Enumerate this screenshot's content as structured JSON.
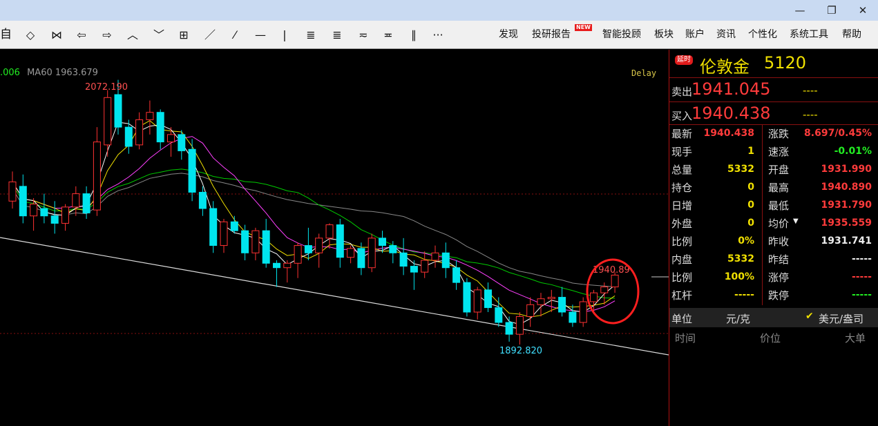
{
  "window": {
    "minimize": "—",
    "restore": "❐",
    "close": "✕"
  },
  "toolbar": {
    "first_char": "自",
    "icons": [
      "prev-icon",
      "next-icon",
      "left-arrow-icon",
      "right-arrow-icon",
      "zoom-in-icon",
      "zoom-out-icon",
      "layout-icon",
      "trend-line-icon",
      "dash-line-icon",
      "h-line-icon",
      "v-line-icon",
      "chan-icon",
      "fib-icon",
      "gann-icon",
      "cross-icon",
      "parallel-icon",
      "more-icon"
    ],
    "icon_glyphs": [
      "◇",
      "⋈",
      "⇦",
      "⇨",
      "︿",
      "﹀",
      "⊞",
      "／",
      "⁄",
      "—",
      "|",
      "≣",
      "≣",
      "≂",
      "≖",
      "∥",
      "···"
    ],
    "menu": [
      "发现",
      "投研报告",
      "智能投顾",
      "板块",
      "账户",
      "资讯",
      "个性化",
      "系统工具",
      "帮助"
    ],
    "new_badge": "NEW"
  },
  "chart": {
    "ma_label_1": ".006",
    "ma_label_2": "MA60 1963.679",
    "delay_label": "Delay",
    "high_label": "2072.190",
    "low_label": "1892.820",
    "last_label": "1940.89",
    "colors": {
      "up": "#ff3232",
      "down": "#00e5ee",
      "ma5": "#ffffff",
      "ma10": "#f0e000",
      "ma20": "#ff40ff",
      "ma60": "#00cc00",
      "ma120": "#888888",
      "trend": "#dddddd"
    }
  },
  "chart_data": {
    "type": "candlestick",
    "ohlc": [
      [
        1990,
        2010,
        1985,
        2003
      ],
      [
        2000,
        2008,
        1975,
        1980
      ],
      [
        1980,
        1992,
        1970,
        1988
      ],
      [
        1985,
        1995,
        1975,
        1980
      ],
      [
        1980,
        1990,
        1968,
        1975
      ],
      [
        1975,
        1988,
        1970,
        1986
      ],
      [
        1986,
        2000,
        1980,
        1995
      ],
      [
        1995,
        2000,
        1978,
        1982
      ],
      [
        1984,
        2040,
        1980,
        2030
      ],
      [
        2028,
        2065,
        2020,
        2060
      ],
      [
        2062,
        2072,
        2035,
        2040
      ],
      [
        2040,
        2045,
        2022,
        2027
      ],
      [
        2028,
        2050,
        2025,
        2045
      ],
      [
        2045,
        2058,
        2035,
        2050
      ],
      [
        2050,
        2052,
        2025,
        2030
      ],
      [
        2030,
        2040,
        2020,
        2035
      ],
      [
        2035,
        2038,
        2018,
        2024
      ],
      [
        2025,
        2032,
        1990,
        1996
      ],
      [
        1996,
        2000,
        1980,
        1985
      ],
      [
        1985,
        1990,
        1955,
        1960
      ],
      [
        1960,
        1978,
        1955,
        1976
      ],
      [
        1976,
        1980,
        1968,
        1970
      ],
      [
        1970,
        1974,
        1950,
        1955
      ],
      [
        1955,
        1972,
        1950,
        1970
      ],
      [
        1970,
        1978,
        1945,
        1948
      ],
      [
        1948,
        1950,
        1932,
        1945
      ],
      [
        1945,
        1950,
        1935,
        1948
      ],
      [
        1948,
        1962,
        1938,
        1960
      ],
      [
        1960,
        1972,
        1950,
        1955
      ],
      [
        1955,
        1968,
        1945,
        1965
      ],
      [
        1965,
        1975,
        1958,
        1974
      ],
      [
        1974,
        1978,
        1945,
        1952
      ],
      [
        1952,
        1960,
        1948,
        1958
      ],
      [
        1958,
        1962,
        1940,
        1945
      ],
      [
        1945,
        1968,
        1942,
        1965
      ],
      [
        1965,
        1970,
        1955,
        1960
      ],
      [
        1960,
        1963,
        1948,
        1955
      ],
      [
        1955,
        1965,
        1940,
        1946
      ],
      [
        1946,
        1950,
        1930,
        1942
      ],
      [
        1942,
        1956,
        1938,
        1950
      ],
      [
        1950,
        1960,
        1945,
        1955
      ],
      [
        1955,
        1962,
        1938,
        1945
      ],
      [
        1945,
        1950,
        1930,
        1935
      ],
      [
        1935,
        1938,
        1912,
        1915
      ],
      [
        1915,
        1932,
        1910,
        1930
      ],
      [
        1930,
        1935,
        1915,
        1918
      ],
      [
        1918,
        1925,
        1905,
        1908
      ],
      [
        1908,
        1912,
        1895,
        1900
      ],
      [
        1900,
        1915,
        1893,
        1912
      ],
      [
        1912,
        1925,
        1905,
        1920
      ],
      [
        1920,
        1928,
        1912,
        1924
      ],
      [
        1924,
        1930,
        1915,
        1925
      ],
      [
        1925,
        1932,
        1912,
        1915
      ],
      [
        1915,
        1920,
        1905,
        1908
      ],
      [
        1908,
        1925,
        1905,
        1922
      ],
      [
        1922,
        1930,
        1915,
        1928
      ],
      [
        1928,
        1935,
        1920,
        1932
      ],
      [
        1932,
        1942,
        1928,
        1940
      ]
    ],
    "high_marker": 2072.19,
    "low_marker": 1892.82,
    "last_marker": 1940.89
  },
  "quote": {
    "delay_badge": "延时",
    "name": "伦敦金",
    "code": "5120",
    "sell_label": "卖出",
    "sell_price": "1941.045",
    "sell_vol": "----",
    "buy_label": "买入",
    "buy_price": "1940.438",
    "buy_vol": "----",
    "left": [
      {
        "label": "最新",
        "value": "1940.438",
        "color": "red"
      },
      {
        "label": "现手",
        "value": "1",
        "color": "yellow"
      },
      {
        "label": "总量",
        "value": "5332",
        "color": "yellow"
      },
      {
        "label": "持仓",
        "value": "0",
        "color": "yellow"
      },
      {
        "label": "日增",
        "value": "0",
        "color": "yellow"
      },
      {
        "label": "外盘",
        "value": "0",
        "color": "yellow"
      },
      {
        "label": "比例",
        "value": "0%",
        "color": "yellow"
      },
      {
        "label": "内盘",
        "value": "5332",
        "color": "yellow"
      },
      {
        "label": "比例",
        "value": "100%",
        "color": "yellow"
      },
      {
        "label": "杠杆",
        "value": "-----",
        "color": "yellow"
      }
    ],
    "right": [
      {
        "label": "涨跌",
        "value": "8.697/0.45%",
        "color": "red"
      },
      {
        "label": "速涨",
        "value": "-0.01%",
        "color": "green"
      },
      {
        "label": "开盘",
        "value": "1931.990",
        "color": "red"
      },
      {
        "label": "最高",
        "value": "1940.890",
        "color": "red"
      },
      {
        "label": "最低",
        "value": "1931.790",
        "color": "red"
      },
      {
        "label": "均价",
        "value": "1935.559",
        "color": "red"
      },
      {
        "label": "昨收",
        "value": "1931.741",
        "color": "white"
      },
      {
        "label": "昨结",
        "value": "-----",
        "color": "white"
      },
      {
        "label": "涨停",
        "value": "-----",
        "color": "red"
      },
      {
        "label": "跌停",
        "value": "-----",
        "color": "green"
      }
    ],
    "unit_label": "单位",
    "unit_value": "元/克",
    "unit_option": "美元/盎司",
    "tick_headers": [
      "时间",
      "价位",
      "大单"
    ]
  }
}
